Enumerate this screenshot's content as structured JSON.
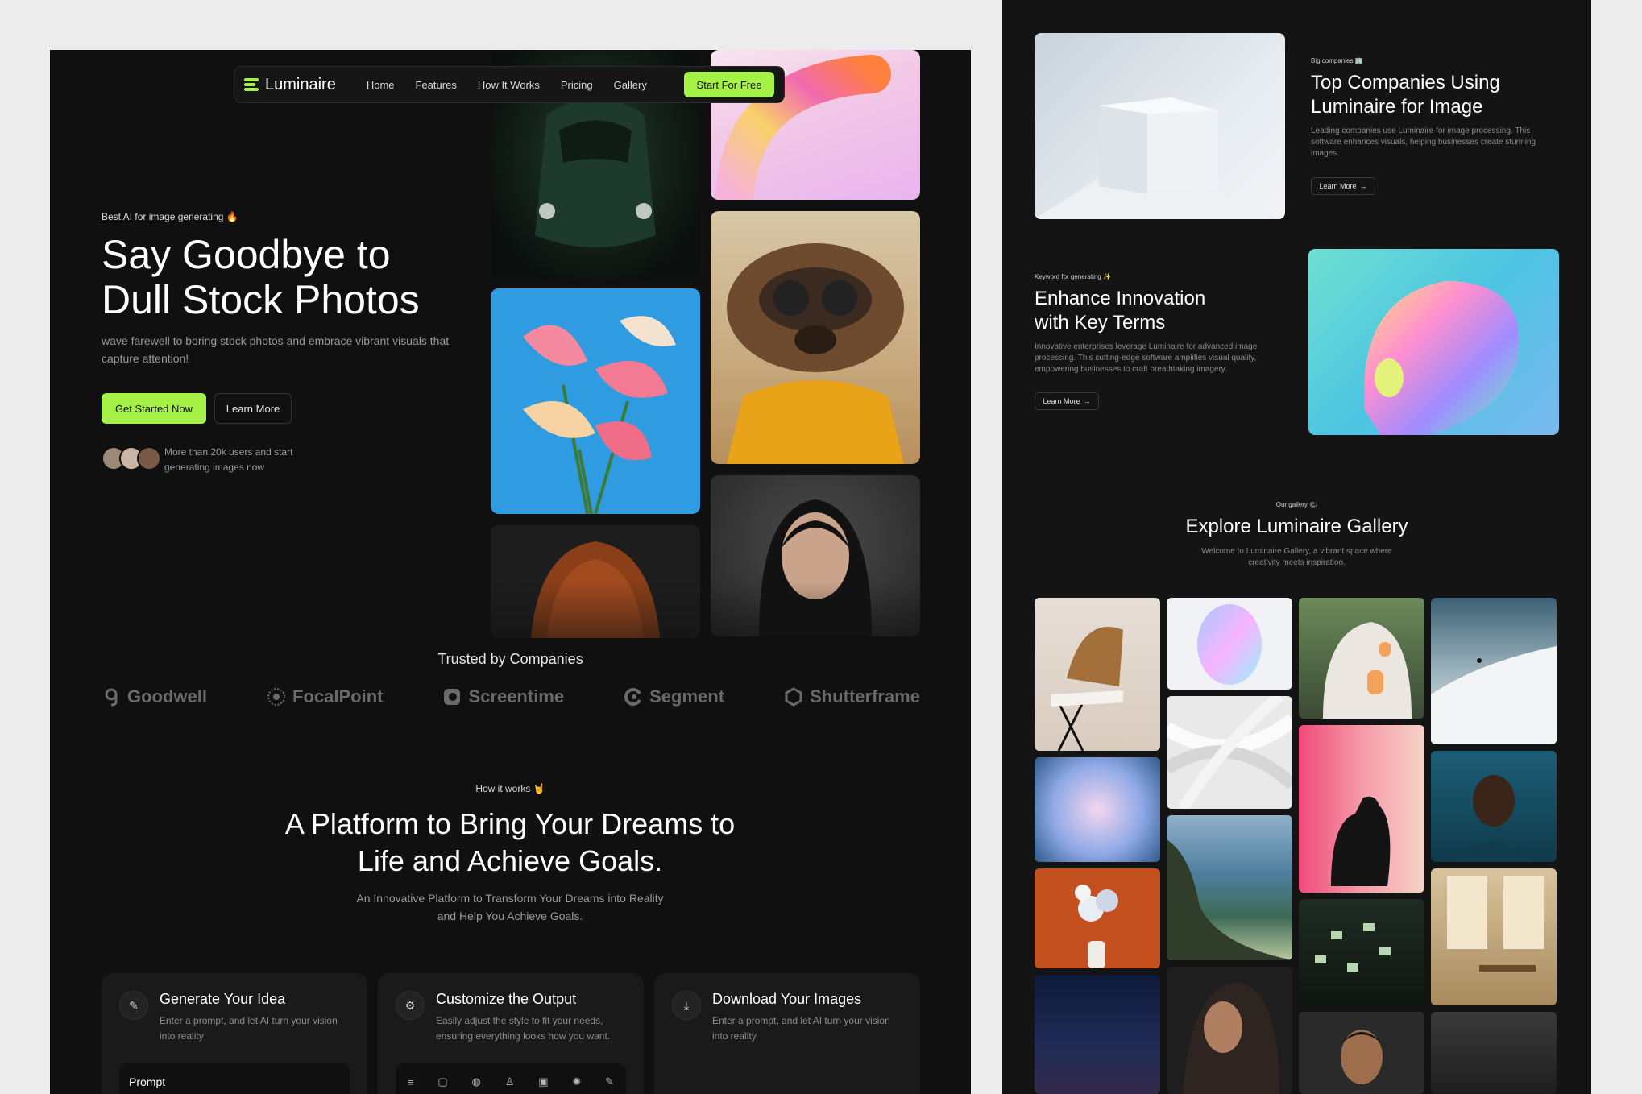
{
  "nav": {
    "brand": "Luminaire",
    "links": [
      "Home",
      "Features",
      "How It Works",
      "Pricing",
      "Gallery"
    ],
    "cta": "Start For Free"
  },
  "hero": {
    "tagline": "Best AI for image generating 🔥",
    "title": "Say Goodbye to Dull Stock Photos",
    "subtitle": "wave farewell to boring stock photos and embrace vibrant visuals that capture attention!",
    "primary_button": "Get Started Now",
    "secondary_button": "Learn More",
    "users_text": "More than 20k users and start generating images now"
  },
  "trusted": {
    "title": "Trusted by Companies",
    "logos": [
      "Goodwell",
      "FocalPoint",
      "Screentime",
      "Segment",
      "Shutterframe"
    ]
  },
  "how": {
    "tag": "How it works 🤘",
    "title": "A Platform to Bring Your Dreams to Life and Achieve Goals.",
    "subtitle": "An Innovative Platform to Transform Your Dreams into Reality and Help You Achieve Goals.",
    "steps": [
      {
        "title": "Generate Your Idea",
        "text": "Enter a prompt, and let AI turn your vision into reality",
        "extra": "Prompt"
      },
      {
        "title": "Customize the Output",
        "text": "Easily adjust the style to fit your needs, ensuring everything looks how you want."
      },
      {
        "title": "Download Your Images",
        "text": "Enter a prompt, and let AI turn your vision into reality"
      }
    ]
  },
  "companies_section": {
    "tag": "Big companies 🏢",
    "title": "Top Companies Using Luminaire for Image",
    "text": "Leading companies use Luminaire for image processing. This software enhances visuals, helping businesses create stunning images.",
    "button": "Learn More"
  },
  "innovation_section": {
    "tag": "Keyword for generating ✨",
    "title": "Enhance Innovation with Key Terms",
    "text": "Innovative enterprises leverage Luminaire for advanced image processing. This cutting-edge software amplifies visual quality, empowering businesses to craft breathtaking imagery.",
    "button": "Learn More"
  },
  "gallery": {
    "tag": "Our gallery 🌤",
    "title": "Explore Luminaire Gallery",
    "subtitle": "Welcome to Luminaire Gallery, a vibrant space where creativity meets inspiration."
  },
  "colors": {
    "accent": "#a6f146",
    "background": "#101010",
    "card": "#1a1a1a"
  }
}
